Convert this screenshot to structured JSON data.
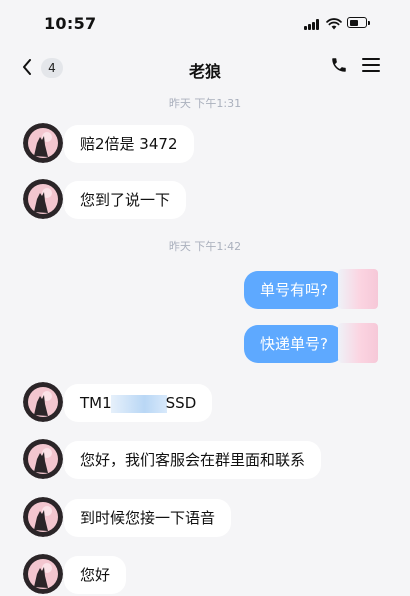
{
  "status_bar": {
    "time": "10:57"
  },
  "nav": {
    "back_badge": "4",
    "title": "老狼"
  },
  "messages": [
    {
      "type": "timestamp",
      "text": "昨天 下午1:31"
    },
    {
      "type": "incoming",
      "text": "赔2倍是 3472"
    },
    {
      "type": "incoming",
      "text": "您到了说一下"
    },
    {
      "type": "timestamp",
      "text": "昨天 下午1:42"
    },
    {
      "type": "outgoing",
      "text": "单号有吗?"
    },
    {
      "type": "outgoing",
      "text": "快递单号?"
    },
    {
      "type": "incoming",
      "text_start": "TM1",
      "text_end": "SSD"
    },
    {
      "type": "incoming",
      "text": "您好，我们客服会在群里面和联系"
    },
    {
      "type": "incoming",
      "text": "到时候您接一下语音"
    },
    {
      "type": "incoming",
      "text": "您好"
    }
  ],
  "colors": {
    "outgoing_bubble": "#5ea9ff",
    "incoming_bubble": "#ffffff",
    "background": "#f5f5f7"
  }
}
